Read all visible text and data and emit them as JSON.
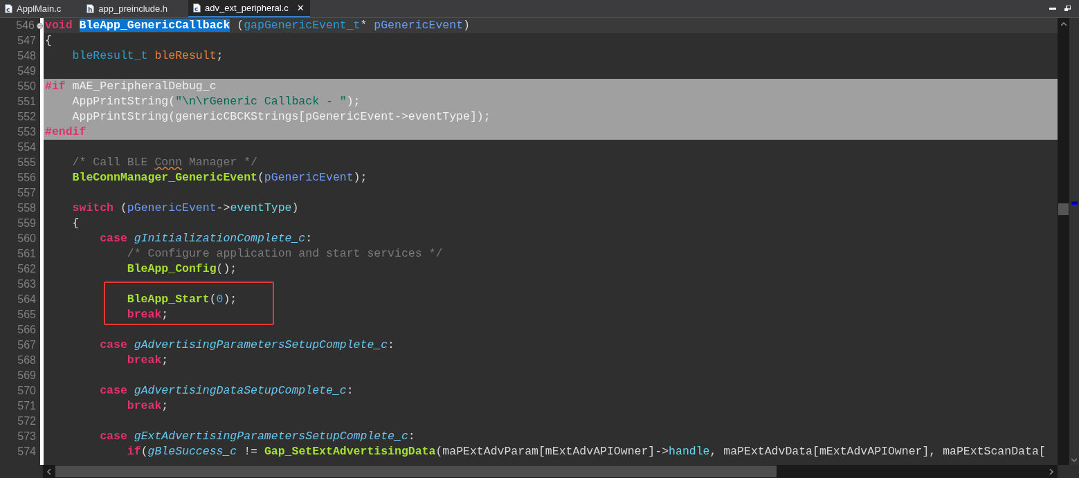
{
  "tabs": [
    {
      "label": "ApplMain.c",
      "file_letter": "c",
      "selected": false
    },
    {
      "label": "app_preinclude.h",
      "file_letter": "h",
      "selected": false
    },
    {
      "label": "adv_ext_peripheral.c",
      "file_letter": "c",
      "selected": true,
      "close": "✕"
    }
  ],
  "editor": {
    "lines": [
      {
        "number": "546",
        "current": true,
        "inactive": false,
        "boxed": false,
        "foldable": true,
        "tokens": [
          {
            "kind": "keyword",
            "text": "void "
          },
          {
            "kind": "selected",
            "text": "BleApp_GenericCallback"
          },
          {
            "kind": "plain",
            "text": " ("
          },
          {
            "kind": "type",
            "text": "gapGenericEvent_t"
          },
          {
            "kind": "plain",
            "text": "* "
          },
          {
            "kind": "param",
            "text": "pGenericEvent"
          },
          {
            "kind": "plain",
            "text": ")"
          }
        ]
      },
      {
        "number": "547",
        "current": false,
        "inactive": false,
        "boxed": false,
        "foldable": false,
        "tokens": [
          {
            "kind": "plain",
            "text": "{"
          }
        ]
      },
      {
        "number": "548",
        "current": false,
        "inactive": false,
        "boxed": false,
        "foldable": false,
        "tokens": [
          {
            "kind": "type",
            "text": "    bleResult_t "
          },
          {
            "kind": "local",
            "text": "bleResult"
          },
          {
            "kind": "plain",
            "text": ";"
          }
        ]
      },
      {
        "number": "549",
        "current": false,
        "inactive": false,
        "boxed": false,
        "foldable": false
      },
      {
        "number": "550",
        "current": false,
        "inactive": true,
        "boxed": false,
        "foldable": false,
        "tokens": [
          {
            "kind": "keyword",
            "text": "#if"
          },
          {
            "kind": "plain",
            "text": " mAE_PeripheralDebug_c"
          }
        ]
      },
      {
        "number": "551",
        "current": false,
        "inactive": true,
        "boxed": false,
        "foldable": false,
        "tokens": [
          {
            "kind": "plain",
            "text": "    AppPrintString("
          },
          {
            "kind": "string",
            "text": "\"\\n\\rGeneric Callback - \""
          },
          {
            "kind": "plain",
            "text": ");"
          }
        ]
      },
      {
        "number": "552",
        "current": false,
        "inactive": true,
        "boxed": false,
        "foldable": false,
        "tokens": [
          {
            "kind": "plain",
            "text": "    AppPrintString(genericCBCKStrings[pGenericEvent->eventType]);"
          }
        ]
      },
      {
        "number": "553",
        "current": false,
        "inactive": true,
        "boxed": false,
        "foldable": false,
        "tokens": [
          {
            "kind": "keyword",
            "text": "#endif"
          }
        ]
      },
      {
        "number": "554",
        "current": false,
        "inactive": false,
        "boxed": false,
        "foldable": false
      },
      {
        "number": "555",
        "current": false,
        "inactive": false,
        "boxed": false,
        "foldable": false,
        "tokens": [
          {
            "kind": "comment",
            "text": "    /* Call BLE "
          },
          {
            "kind": "misspelled",
            "text": "Conn"
          },
          {
            "kind": "comment",
            "text": " Manager */"
          }
        ]
      },
      {
        "number": "556",
        "current": false,
        "inactive": false,
        "boxed": false,
        "foldable": false,
        "tokens": [
          {
            "kind": "function",
            "text": "    BleConnManager_GenericEvent"
          },
          {
            "kind": "plain",
            "text": "("
          },
          {
            "kind": "param",
            "text": "pGenericEvent"
          },
          {
            "kind": "plain",
            "text": ");"
          }
        ]
      },
      {
        "number": "557",
        "current": false,
        "inactive": false,
        "boxed": false,
        "foldable": false
      },
      {
        "number": "558",
        "current": false,
        "inactive": false,
        "boxed": false,
        "foldable": false,
        "tokens": [
          {
            "kind": "keyword",
            "text": "    switch"
          },
          {
            "kind": "plain",
            "text": " ("
          },
          {
            "kind": "param",
            "text": "pGenericEvent"
          },
          {
            "kind": "plain",
            "text": "->"
          },
          {
            "kind": "field",
            "text": "eventType"
          },
          {
            "kind": "plain",
            "text": ")"
          }
        ]
      },
      {
        "number": "559",
        "current": false,
        "inactive": false,
        "boxed": false,
        "foldable": false,
        "tokens": [
          {
            "kind": "plain",
            "text": "    {"
          }
        ]
      },
      {
        "number": "560",
        "current": false,
        "inactive": false,
        "boxed": false,
        "foldable": false,
        "tokens": [
          {
            "kind": "keyword",
            "text": "        case "
          },
          {
            "kind": "constant",
            "text": "gInitializationComplete_c"
          },
          {
            "kind": "plain",
            "text": ":"
          }
        ]
      },
      {
        "number": "561",
        "current": false,
        "inactive": false,
        "boxed": false,
        "foldable": false,
        "tokens": [
          {
            "kind": "comment",
            "text": "            /* Configure application and start services */"
          }
        ]
      },
      {
        "number": "562",
        "current": false,
        "inactive": false,
        "boxed": false,
        "foldable": false,
        "tokens": [
          {
            "kind": "function",
            "text": "            BleApp_Config"
          },
          {
            "kind": "plain",
            "text": "();"
          }
        ]
      },
      {
        "number": "563",
        "current": false,
        "inactive": false,
        "boxed": false,
        "foldable": false
      },
      {
        "number": "564",
        "current": false,
        "inactive": false,
        "boxed": true,
        "foldable": false,
        "tokens": [
          {
            "kind": "function",
            "text": "            BleApp_Start"
          },
          {
            "kind": "plain",
            "text": "("
          },
          {
            "kind": "number",
            "text": "0"
          },
          {
            "kind": "plain",
            "text": ");"
          }
        ]
      },
      {
        "number": "565",
        "current": false,
        "inactive": false,
        "boxed": true,
        "foldable": false,
        "tokens": [
          {
            "kind": "keyword",
            "text": "            break"
          },
          {
            "kind": "plain",
            "text": ";"
          }
        ]
      },
      {
        "number": "566",
        "current": false,
        "inactive": false,
        "boxed": false,
        "foldable": false
      },
      {
        "number": "567",
        "current": false,
        "inactive": false,
        "boxed": false,
        "foldable": false,
        "tokens": [
          {
            "kind": "keyword",
            "text": "        case "
          },
          {
            "kind": "constant",
            "text": "gAdvertisingParametersSetupComplete_c"
          },
          {
            "kind": "plain",
            "text": ":"
          }
        ]
      },
      {
        "number": "568",
        "current": false,
        "inactive": false,
        "boxed": false,
        "foldable": false,
        "tokens": [
          {
            "kind": "keyword",
            "text": "            break"
          },
          {
            "kind": "plain",
            "text": ";"
          }
        ]
      },
      {
        "number": "569",
        "current": false,
        "inactive": false,
        "boxed": false,
        "foldable": false
      },
      {
        "number": "570",
        "current": false,
        "inactive": false,
        "boxed": false,
        "foldable": false,
        "tokens": [
          {
            "kind": "keyword",
            "text": "        case "
          },
          {
            "kind": "constant",
            "text": "gAdvertisingDataSetupComplete_c"
          },
          {
            "kind": "plain",
            "text": ":"
          }
        ]
      },
      {
        "number": "571",
        "current": false,
        "inactive": false,
        "boxed": false,
        "foldable": false,
        "tokens": [
          {
            "kind": "keyword",
            "text": "            break"
          },
          {
            "kind": "plain",
            "text": ";"
          }
        ]
      },
      {
        "number": "572",
        "current": false,
        "inactive": false,
        "boxed": false,
        "foldable": false
      },
      {
        "number": "573",
        "current": false,
        "inactive": false,
        "boxed": false,
        "foldable": false,
        "tokens": [
          {
            "kind": "keyword",
            "text": "        case "
          },
          {
            "kind": "constant",
            "text": "gExtAdvertisingParametersSetupComplete_c"
          },
          {
            "kind": "plain",
            "text": ":"
          }
        ]
      },
      {
        "number": "574",
        "current": false,
        "inactive": false,
        "boxed": false,
        "foldable": false,
        "tokens": [
          {
            "kind": "keyword",
            "text": "            if"
          },
          {
            "kind": "plain",
            "text": "("
          },
          {
            "kind": "constant",
            "text": "gBleSuccess_c"
          },
          {
            "kind": "plain",
            "text": " != "
          },
          {
            "kind": "function",
            "text": "Gap_SetExtAdvertisingData"
          },
          {
            "kind": "plain",
            "text": "(maPExtAdvParam[mExtAdvAPIOwner]->"
          },
          {
            "kind": "field",
            "text": "handle"
          },
          {
            "kind": "plain",
            "text": ", maPExtAdvData[mExtAdvAPIOwner], maPExtScanData["
          }
        ]
      }
    ]
  }
}
